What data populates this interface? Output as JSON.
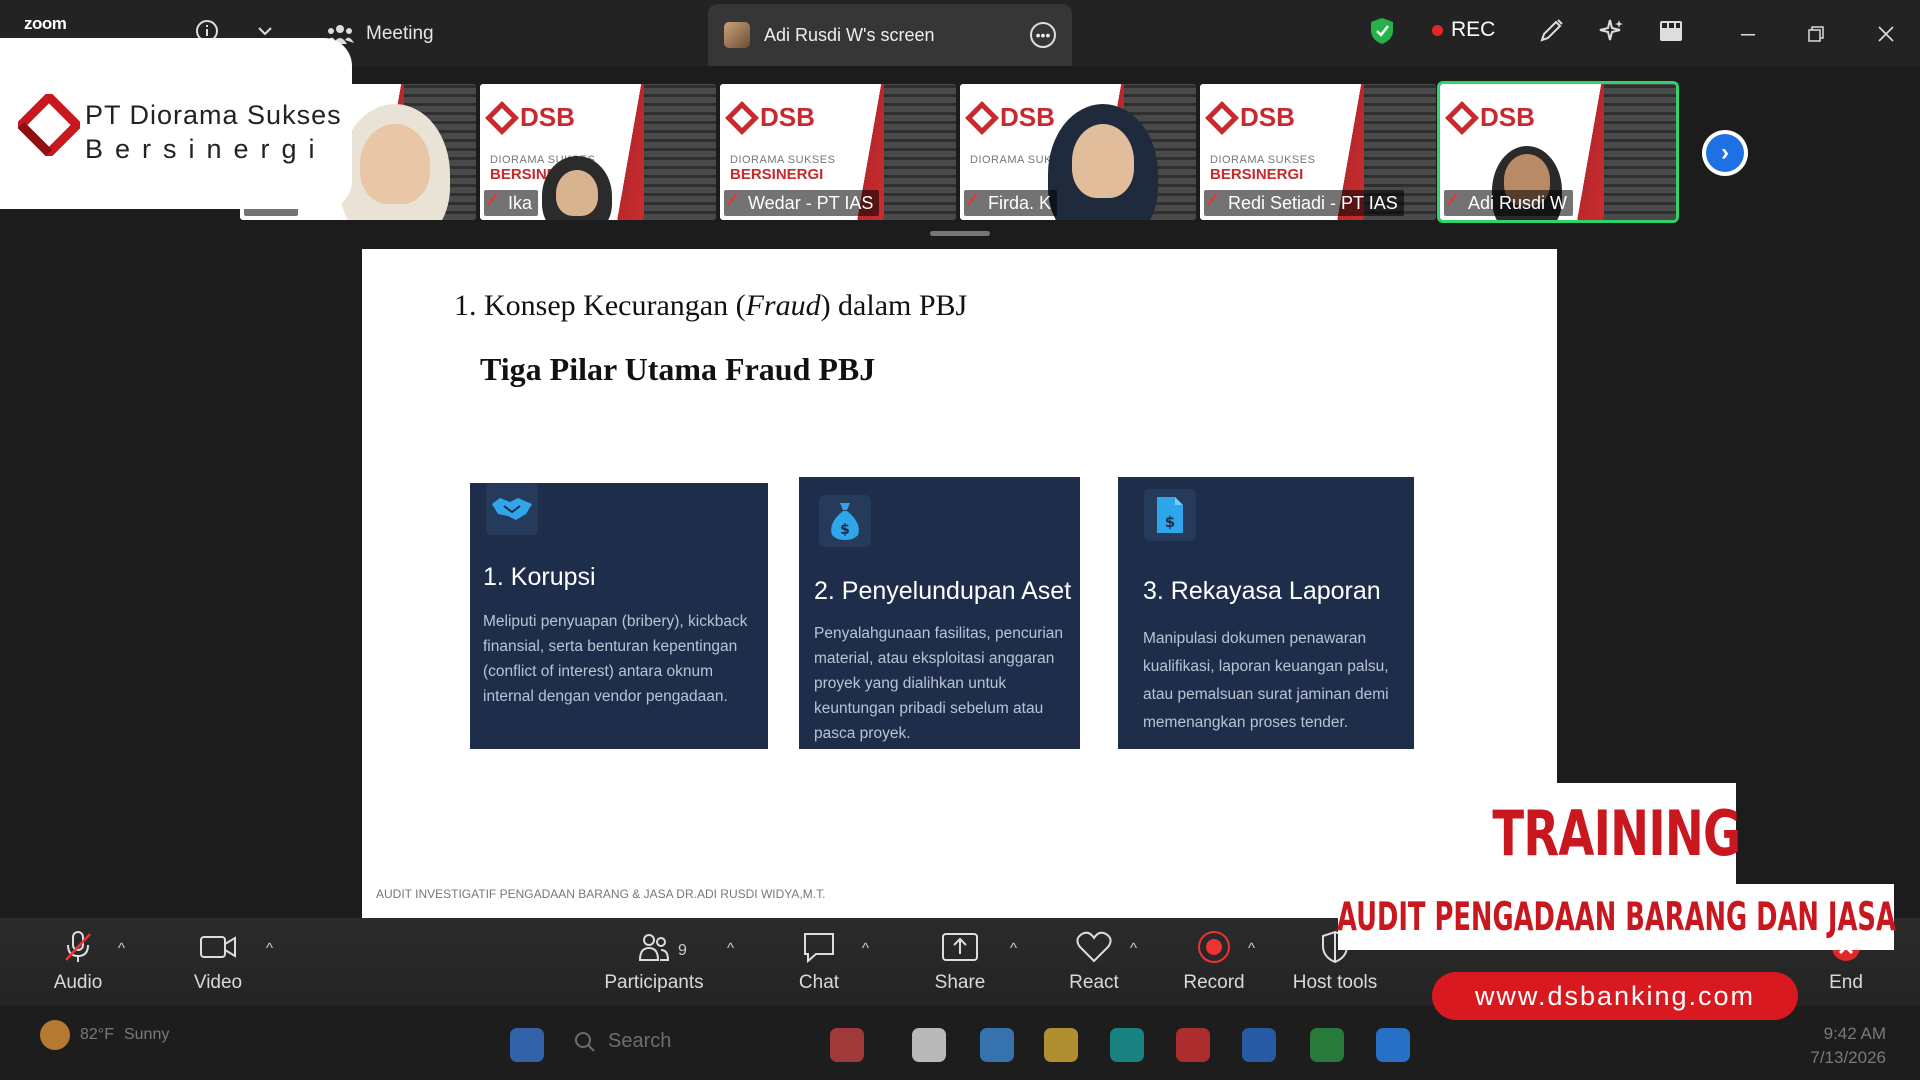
{
  "topbar": {
    "app_logo": "zoom",
    "meeting_label": "Meeting",
    "screen_tab_label": "Adi Rusdi W's screen",
    "rec_label": "REC"
  },
  "company_logo": {
    "line1": "PT Diorama  Sukses",
    "line2": "Bersinergi"
  },
  "participants": [
    {
      "name": "ani"
    },
    {
      "name": "Ika"
    },
    {
      "name": "Wedar - PT IAS"
    },
    {
      "name": "Firda. K"
    },
    {
      "name": "Redi Setiadi - PT IAS"
    },
    {
      "name": "Adi Rusdi W"
    }
  ],
  "tile_brand": {
    "logo_text": "DSB",
    "tagline": "DIORAMA SUKSES",
    "tagline2": "BERSINERGI"
  },
  "slide": {
    "title_prefix": "1. Konsep Kecurangan (",
    "title_italic": "Fraud",
    "title_suffix": ") dalam PBJ",
    "subtitle": "Tiga Pilar Utama Fraud PBJ",
    "cards": [
      {
        "icon": "handshake-icon",
        "title": "1. Korupsi",
        "body": "Meliputi penyuapan (bribery), kickback finansial, serta benturan kepentingan (conflict of interest) antara oknum internal dengan vendor pengadaan."
      },
      {
        "icon": "money-bag-icon",
        "title": "2. Penyelundupan Aset",
        "body": "Penyalahgunaan fasilitas, pencurian material, atau eksploitasi anggaran proyek yang dialihkan untuk keuntungan pribadi sebelum atau pasca proyek."
      },
      {
        "icon": "document-dollar-icon",
        "title": "3. Rekayasa Laporan",
        "body": "Manipulasi dokumen penawaran kualifikasi, laporan keuangan palsu, atau pemalsuan surat jaminan demi memenangkan proses tender."
      }
    ],
    "footer": "AUDIT INVESTIGATIF PENGADAAN BARANG & JASA DR.ADI RUSDI WIDYA,M.T."
  },
  "banner": {
    "training": "TRAINING",
    "audit": "AUDIT PENGADAAN BARANG DAN JASA",
    "website": "www.dsbanking.com"
  },
  "toolbar": {
    "audio": "Audio",
    "video": "Video",
    "participants": "Participants",
    "participant_count": "9",
    "chat": "Chat",
    "share": "Share",
    "react": "React",
    "record": "Record",
    "host_tools": "Host tools",
    "end": "End"
  },
  "taskbar": {
    "temperature": "82°F",
    "weather": "Sunny",
    "search_placeholder": "Search",
    "time": "9:42 AM",
    "date": "7/13/2026"
  },
  "colors": {
    "brand_red": "#c8171e",
    "card_bg": "#1e2e4a",
    "active_green": "#2fd36b",
    "accent_blue": "#1f6fe5"
  }
}
